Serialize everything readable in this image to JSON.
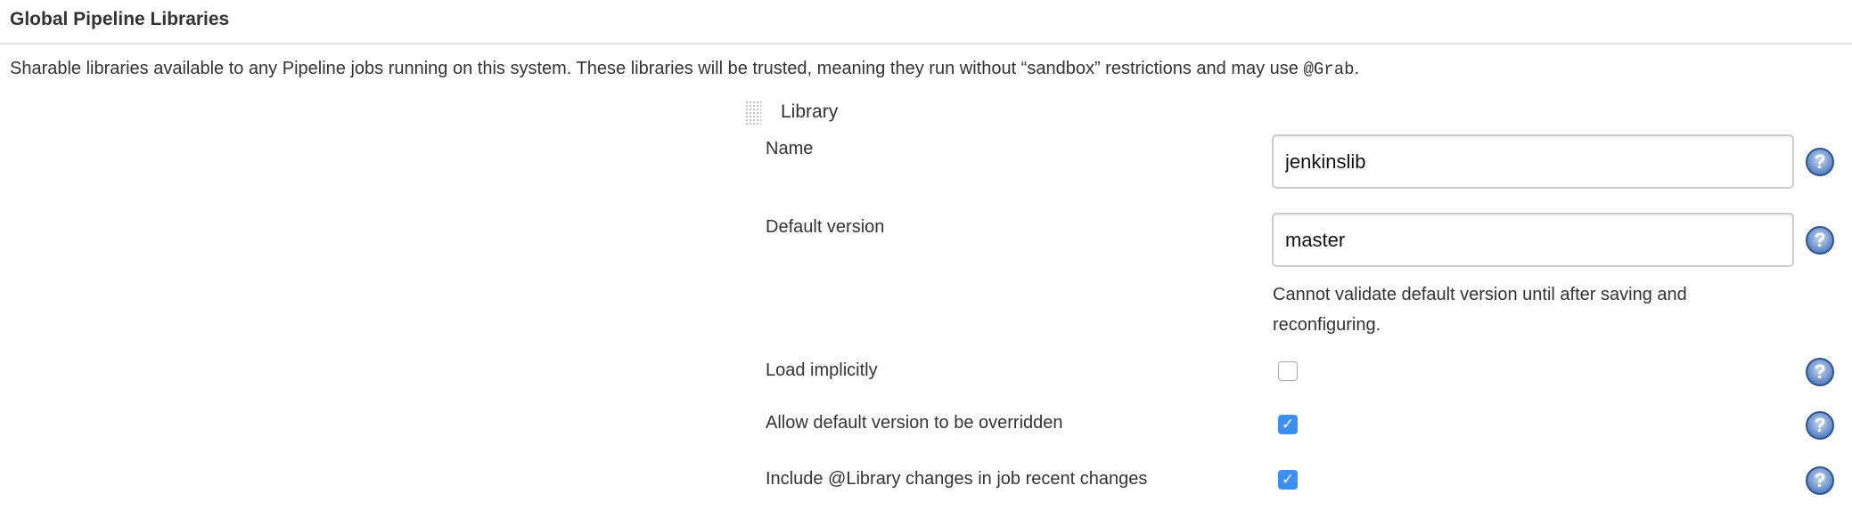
{
  "section": {
    "title": "Global Pipeline Libraries",
    "description_prefix": "Sharable libraries available to any Pipeline jobs running on this system. These libraries will be trusted, meaning they run without “sandbox” restrictions and may use ",
    "description_code": "@Grab",
    "description_suffix": "."
  },
  "library": {
    "header": "Library",
    "name": {
      "label": "Name",
      "value": "jenkinslib"
    },
    "default_version": {
      "label": "Default version",
      "value": "master",
      "note": "Cannot validate default version until after saving and reconfiguring."
    },
    "load_implicitly": {
      "label": "Load implicitly",
      "checked": false
    },
    "allow_override": {
      "label": "Allow default version to be overridden",
      "checked": true
    },
    "include_changes": {
      "label": "Include @Library changes in job recent changes",
      "checked": true
    }
  },
  "icons": {
    "help": "?",
    "check": "✓"
  },
  "colors": {
    "checkbox_checked": "#3b8ff0",
    "help_icon": "#5c85c4"
  }
}
